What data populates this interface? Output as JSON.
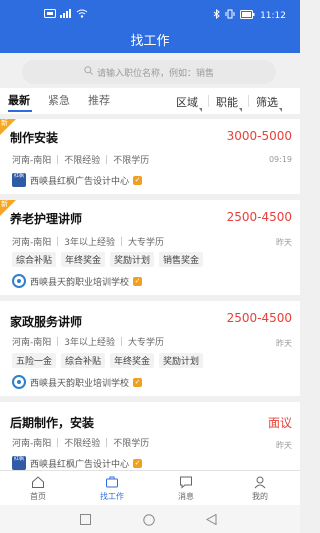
{
  "status_bar": {
    "left_icons": [
      "sim-icon",
      "signal-icon",
      "wifi-icon"
    ],
    "time": "11:12",
    "right_icons": [
      "bluetooth-icon",
      "vibrate-icon",
      "battery-icon"
    ]
  },
  "header": {
    "title": "找工作"
  },
  "search": {
    "placeholder": "请输入职位名称，例如：销售"
  },
  "tabs": [
    {
      "label": "最新",
      "active": true
    },
    {
      "label": "紧急",
      "active": false
    },
    {
      "label": "推荐",
      "active": false
    }
  ],
  "filters": [
    "区域",
    "职能",
    "筛选"
  ],
  "jobs": [
    {
      "new_label": "新",
      "title": "制作安装",
      "salary": "3000-5000",
      "location": "河南-南阳",
      "experience": "不限经验",
      "education": "不限学历",
      "time": "09:19",
      "benefits": [],
      "company": "西峡县红枫广告设计中心",
      "logo_text": "红枫"
    },
    {
      "new_label": "新",
      "title": "养老护理讲师",
      "salary": "2500-4500",
      "location": "河南-南阳",
      "experience": "3年以上经验",
      "education": "大专学历",
      "time": "昨天",
      "benefits": [
        "综合补贴",
        "年终奖金",
        "奖励计划",
        "销售奖金"
      ],
      "company": "西峡县天韵职业培训学校"
    },
    {
      "new_label": "",
      "title": "家政服务讲师",
      "salary": "2500-4500",
      "location": "河南-南阳",
      "experience": "3年以上经验",
      "education": "大专学历",
      "time": "昨天",
      "benefits": [
        "五险一金",
        "综合补贴",
        "年终奖金",
        "奖励计划"
      ],
      "company": "西峡县天韵职业培训学校"
    },
    {
      "new_label": "",
      "title": "后期制作，安装",
      "salary": "面议",
      "location": "河南-南阳",
      "experience": "不限经验",
      "education": "不限学历",
      "time": "昨天",
      "benefits": [],
      "company": "西峡县红枫广告设计中心",
      "logo_text": "红枫"
    }
  ],
  "bottom_nav": [
    {
      "label": "首页",
      "icon": "home-icon",
      "active": false
    },
    {
      "label": "找工作",
      "icon": "briefcase-icon",
      "active": true
    },
    {
      "label": "消息",
      "icon": "message-icon",
      "active": false
    },
    {
      "label": "我的",
      "icon": "user-icon",
      "active": false
    }
  ],
  "system_nav": [
    "square-icon",
    "circle-icon",
    "back-triangle-icon"
  ],
  "colors": {
    "primary": "#2e6de0",
    "salary": "#e8413b",
    "badge": "#f5a623"
  }
}
